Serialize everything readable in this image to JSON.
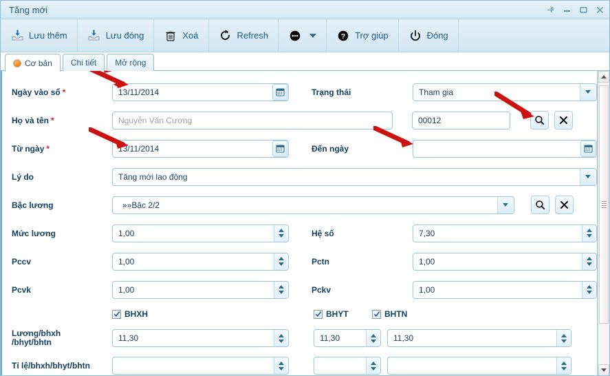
{
  "window": {
    "title": "Tăng mới",
    "controls": [
      {
        "name": "pin-icon",
        "label": "Pin"
      },
      {
        "name": "minimize-icon",
        "label": "Minimize"
      },
      {
        "name": "maximize-icon",
        "label": "Maximize"
      },
      {
        "name": "close-icon",
        "label": "Close"
      }
    ]
  },
  "toolbar": {
    "buttons": [
      {
        "label": "Lưu thêm",
        "icon": "save-add-icon"
      },
      {
        "label": "Lưu đóng",
        "icon": "save-close-icon"
      },
      {
        "label": "Xoá",
        "icon": "trash-icon"
      },
      {
        "label": "Refresh",
        "icon": "refresh-icon"
      },
      {
        "label": "",
        "icon": "more-options-icon"
      },
      {
        "label": "Trợ giúp",
        "icon": "help-icon"
      },
      {
        "label": "Đóng",
        "icon": "power-icon"
      }
    ]
  },
  "tabs": [
    {
      "label": "Cơ bản",
      "active": true
    },
    {
      "label": "Chi tiết",
      "active": false
    },
    {
      "label": "Mở rộng",
      "active": false
    }
  ],
  "form": {
    "ngay_vao_so": {
      "label": "Ngày vào sổ",
      "required": true,
      "value": "13/11/2014"
    },
    "trang_thai": {
      "label": "Trạng thái",
      "required": false,
      "value": "Tham gia"
    },
    "ho_va_ten": {
      "label": "Họ và tên",
      "required": true,
      "value": "Nguyễn Văn Cương",
      "is_placeholder": true
    },
    "ma_nv": {
      "label": "",
      "value": "00012"
    },
    "tu_ngay": {
      "label": "Từ ngày",
      "required": true,
      "value": "13/11/2014"
    },
    "den_ngay": {
      "label": "Đến ngày",
      "required": false,
      "value": ""
    },
    "ly_do": {
      "label": "Lý do",
      "value": "Tăng mới lao động"
    },
    "bac_luong": {
      "label": "Bậc lương",
      "value": "»»Bậc 2/2"
    },
    "muc_luong": {
      "label": "Mức lương",
      "value": "1,00"
    },
    "he_so": {
      "label": "Hệ số",
      "value": "7,30"
    },
    "pccv": {
      "label": "Pccv",
      "value": "1,00"
    },
    "pctn": {
      "label": "Pctn",
      "value": "1,00"
    },
    "pcvk": {
      "label": "Pcvk",
      "value": "1,00"
    },
    "pckv": {
      "label": "Pckv",
      "value": "1,00"
    },
    "checkboxes": [
      {
        "label": "BHXH",
        "checked": true
      },
      {
        "label": "BHYT",
        "checked": true
      },
      {
        "label": "BHTN",
        "checked": true
      }
    ],
    "luong_bhxh": {
      "label_line1": "Lương/bhxh",
      "label_line2": "/bhyt/bhtn",
      "bhxh": "11,30",
      "bhyt": "11,30",
      "bhtn": "11,30"
    },
    "ty_le": {
      "label": "Tỉ lệ/bhxh/bhyt/bhtn",
      "bhxh": "",
      "bhyt": "",
      "bhtn": ""
    }
  },
  "colors": {
    "accent": "#1f5f8b",
    "border": "#99c6de",
    "required": "#e02020",
    "tab_dot": "#f07e10",
    "annotation_arrow": "#cc1111"
  }
}
